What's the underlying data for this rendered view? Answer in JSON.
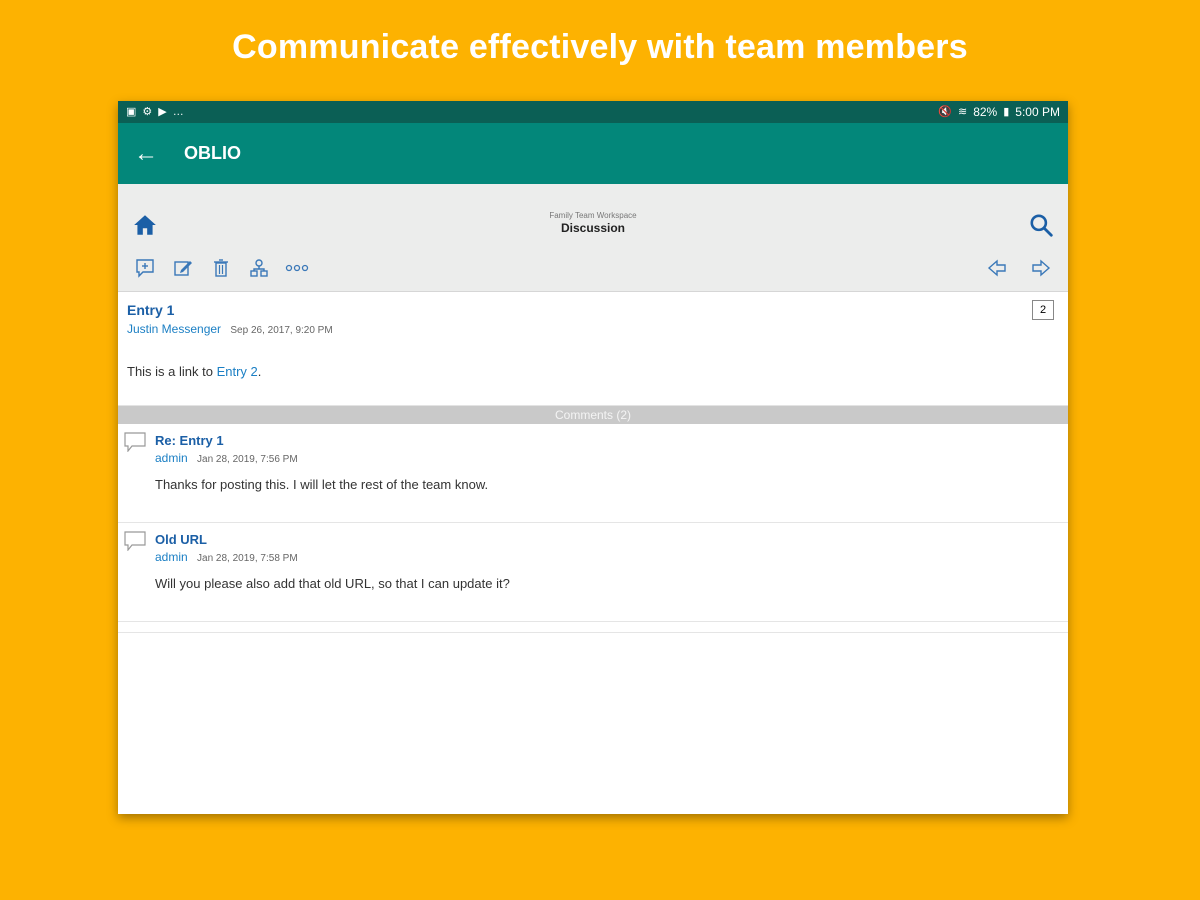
{
  "headline": "Communicate effectively with team members",
  "status_bar": {
    "left_icons": [
      "image-icon",
      "settings-icon",
      "play-icon",
      "more-icon"
    ],
    "battery": "82%",
    "time": "5:00 PM"
  },
  "app_bar": {
    "title": "OBLIO"
  },
  "toolbar": {
    "workspace": "Family Team Workspace",
    "section": "Discussion"
  },
  "entry": {
    "title": "Entry 1",
    "author": "Justin Messenger",
    "date": "Sep 26, 2017, 9:20 PM",
    "body_prefix": "This is a link to ",
    "body_link": "Entry 2",
    "body_suffix": ".",
    "comment_count": "2"
  },
  "comments_header": "Comments (2)",
  "comments": [
    {
      "title": "Re: Entry 1",
      "author": "admin",
      "date": "Jan 28, 2019, 7:56 PM",
      "body": "Thanks for posting this. I will let the rest of the team know."
    },
    {
      "title": "Old URL",
      "author": "admin",
      "date": "Jan 28, 2019, 7:58 PM",
      "body": "Will you please also add that old URL, so that I can update it?"
    }
  ],
  "colors": {
    "background": "#FDB201",
    "status_bar": "#0B5F55",
    "app_bar": "#03877A",
    "link": "#1B7FC4",
    "title": "#1B5FA6"
  }
}
